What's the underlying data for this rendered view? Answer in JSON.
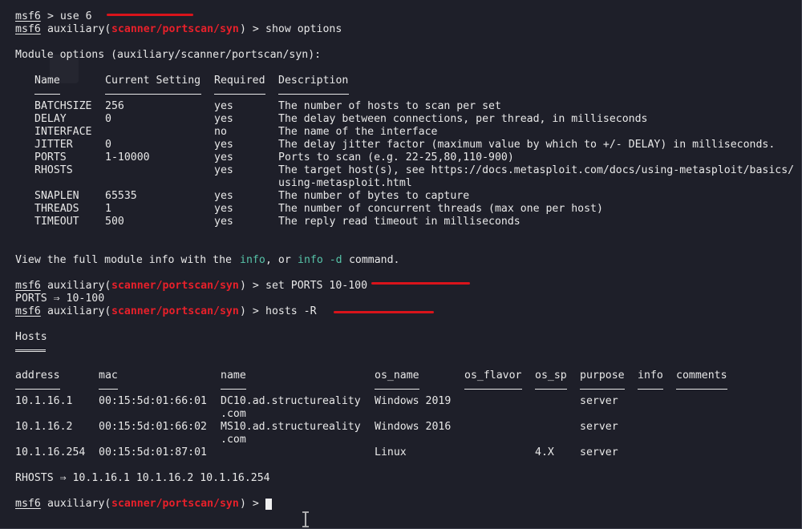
{
  "prompt": {
    "msf": "msf6",
    "open": " auxiliary(",
    "module": "scanner/portscan/syn",
    "close": ") > "
  },
  "lines": {
    "l1_rest": " > use 6",
    "l2_cmd": "show options",
    "l4": "Module options (auxiliary/scanner/portscan/syn):",
    "view_a": "View the full module info with the ",
    "view_info": "info",
    "view_b": ", or ",
    "view_infod": "info -d",
    "view_c": " command.",
    "set_cmd": "set PORTS 10-100",
    "ports_out": "PORTS ⇒ 10-100",
    "hosts_cmd": "hosts -R",
    "hosts_title": "Hosts",
    "rhosts_out": "RHOSTS ⇒ 10.1.16.1 10.1.16.2 10.1.16.254"
  },
  "options": {
    "headers": [
      "Name",
      "Current Setting",
      "Required",
      "Description"
    ],
    "rows": [
      {
        "name": "BATCHSIZE",
        "setting": "256",
        "required": "yes",
        "desc": "The number of hosts to scan per set",
        "desc2": ""
      },
      {
        "name": "DELAY",
        "setting": "0",
        "required": "yes",
        "desc": "The delay between connections, per thread, in milliseconds",
        "desc2": ""
      },
      {
        "name": "INTERFACE",
        "setting": "",
        "required": "no",
        "desc": "The name of the interface",
        "desc2": ""
      },
      {
        "name": "JITTER",
        "setting": "0",
        "required": "yes",
        "desc": "The delay jitter factor (maximum value by which to +/- DELAY) in milliseconds.",
        "desc2": ""
      },
      {
        "name": "PORTS",
        "setting": "1-10000",
        "required": "yes",
        "desc": "Ports to scan (e.g. 22-25,80,110-900)",
        "desc2": ""
      },
      {
        "name": "RHOSTS",
        "setting": "",
        "required": "yes",
        "desc": "The target host(s), see https://docs.metasploit.com/docs/using-metasploit/basics/",
        "desc2": "using-metasploit.html"
      },
      {
        "name": "SNAPLEN",
        "setting": "65535",
        "required": "yes",
        "desc": "The number of bytes to capture",
        "desc2": ""
      },
      {
        "name": "THREADS",
        "setting": "1",
        "required": "yes",
        "desc": "The number of concurrent threads (max one per host)",
        "desc2": ""
      },
      {
        "name": "TIMEOUT",
        "setting": "500",
        "required": "yes",
        "desc": "The reply read timeout in milliseconds",
        "desc2": ""
      }
    ]
  },
  "hosts": {
    "headers": [
      "address",
      "mac",
      "name",
      "os_name",
      "os_flavor",
      "os_sp",
      "purpose",
      "info",
      "comments"
    ],
    "rows": [
      {
        "address": "10.1.16.1",
        "mac": "00:15:5d:01:66:01",
        "name": "DC10.ad.structureality",
        "name2": ".com",
        "os_name": "Windows 2019",
        "os_flavor": "",
        "os_sp": "",
        "purpose": "server",
        "info": "",
        "comments": ""
      },
      {
        "address": "10.1.16.2",
        "mac": "00:15:5d:01:66:02",
        "name": "MS10.ad.structureality",
        "name2": ".com",
        "os_name": "Windows 2016",
        "os_flavor": "",
        "os_sp": "",
        "purpose": "server",
        "info": "",
        "comments": ""
      },
      {
        "address": "10.1.16.254",
        "mac": "00:15:5d:01:87:01",
        "name": "",
        "name2": "",
        "os_name": "Linux",
        "os_flavor": "",
        "os_sp": "4.X",
        "purpose": "server",
        "info": "",
        "comments": ""
      }
    ]
  },
  "colors": {
    "background": "#1e1f29",
    "text": "#e8e8e8",
    "module": "#e8202a",
    "info_link": "#57c3a8",
    "annotation": "#d9141b"
  }
}
